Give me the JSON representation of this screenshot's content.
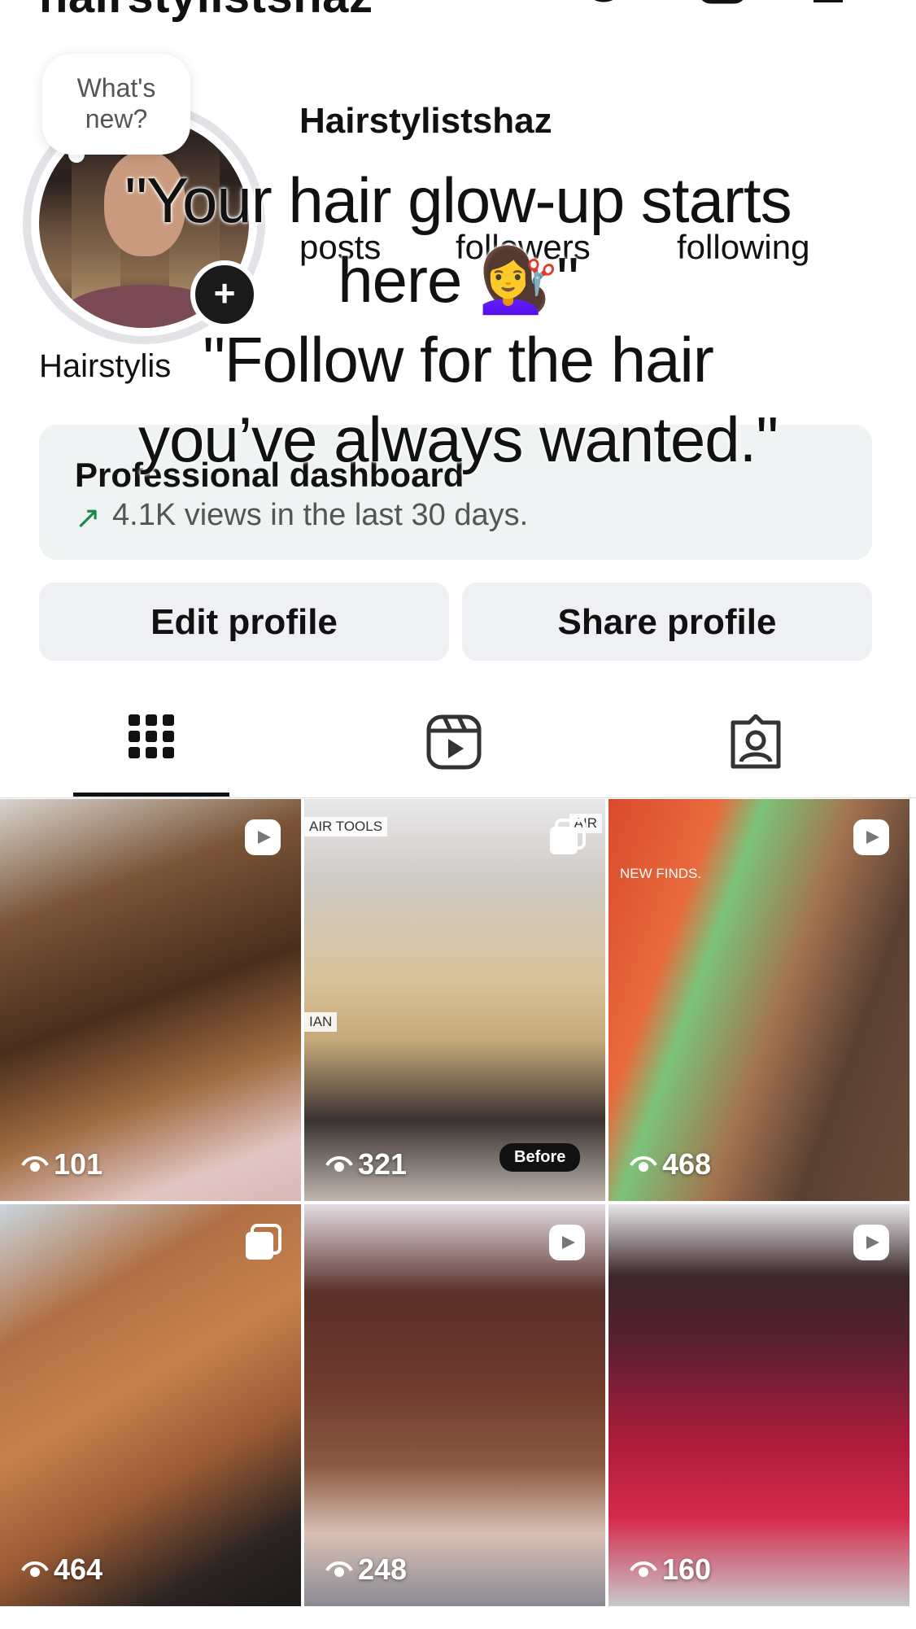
{
  "header": {
    "username": "hairstylistshaz"
  },
  "profile": {
    "whats_new": "What's new?",
    "display_name": "Hairstylistshaz",
    "stats": {
      "posts_label": "posts",
      "followers_label": "followers",
      "following_label": "following"
    },
    "bio_name": "Hairstylis"
  },
  "overlay_text": {
    "line1": "\"Your hair glow-up starts",
    "line2": "here 💇‍♀️\"",
    "line3": "\"Follow for the hair",
    "line4": "you’ve always wanted.\""
  },
  "dashboard": {
    "title": "Professional dashboard",
    "arrow": "↗",
    "subtitle": "4.1K views in the last 30 days."
  },
  "buttons": {
    "edit": "Edit profile",
    "share": "Share profile"
  },
  "tabs": [
    {
      "name": "grid",
      "icon": "grid-icon",
      "active": true
    },
    {
      "name": "reels",
      "icon": "reels-icon",
      "active": false
    },
    {
      "name": "tagged",
      "icon": "tagged-icon",
      "active": false
    }
  ],
  "posts": [
    {
      "views": "101",
      "type": "reel"
    },
    {
      "views": "321",
      "type": "carousel",
      "badge": "Before",
      "sign_text_1": "AIR TOOLS",
      "sign_text_2": "AIR",
      "sign_text_3": "IAN"
    },
    {
      "views": "468",
      "type": "reel",
      "sign_text": "NEW FINDS."
    },
    {
      "views": "464",
      "type": "carousel"
    },
    {
      "views": "248",
      "type": "reel"
    },
    {
      "views": "160",
      "type": "reel"
    }
  ],
  "colors": {
    "accent_green": "#1a8a4a",
    "button_bg": "#eff0f3",
    "dashboard_bg": "#eff3f3"
  }
}
